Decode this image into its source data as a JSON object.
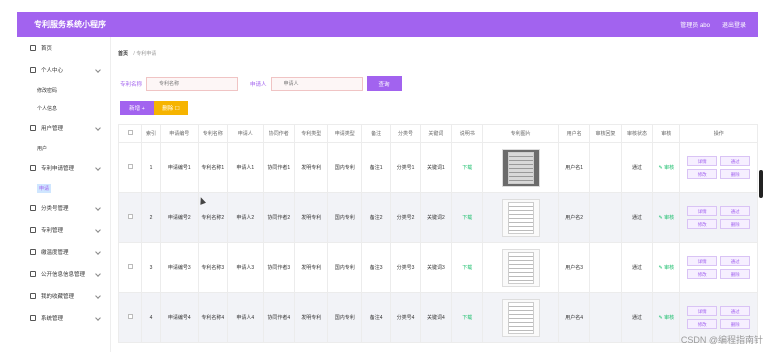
{
  "app": {
    "title": "专利服务系统小程序",
    "user": "管理员 abo",
    "logout": "退出登录"
  },
  "sidebar": {
    "items": [
      {
        "label": "首页"
      },
      {
        "label": "个人中心",
        "subs": [
          "修改密码",
          "个人信息"
        ]
      },
      {
        "label": "用户管理",
        "subs": [
          "用户"
        ]
      },
      {
        "label": "专利申请管理",
        "subs": [
          "申请"
        ]
      },
      {
        "label": "分类号管理"
      },
      {
        "label": "专利管理"
      },
      {
        "label": "缴温度管理"
      },
      {
        "label": "公开信息信息管理"
      },
      {
        "label": "我的收藏管理"
      },
      {
        "label": "系统管理"
      }
    ]
  },
  "breadcrumb": {
    "home": "首页",
    "sep": "/",
    "current": "专利申请"
  },
  "filters": {
    "label1": "专利名称",
    "placeholder1": "专利名称",
    "label2": "申请人",
    "placeholder2": "申请人",
    "search": "查询"
  },
  "actions": {
    "add": "新增 +",
    "delete": "删除 ☐"
  },
  "table": {
    "headers": [
      "索引",
      "申请编号",
      "专利名称",
      "申请人",
      "协同作者",
      "专利类型",
      "申请类型",
      "备注",
      "分类号",
      "关键词",
      "说明书",
      "专利图片",
      "用户名",
      "审核回复",
      "审核状态",
      "审核",
      "操作"
    ],
    "rows": [
      {
        "index": "1",
        "no": "申请编号1",
        "name": "专利名称1",
        "applicant": "申请人1",
        "coauthor": "协同作者1",
        "type": "发明专利",
        "apptype": "国内专利",
        "note": "备注1",
        "cls": "分类号1",
        "kw": "关键词1",
        "manual": "下载",
        "user": "用户名1",
        "reply": "",
        "status": "通过",
        "review": "审核"
      },
      {
        "index": "2",
        "no": "申请编号2",
        "name": "专利名称2",
        "applicant": "申请人2",
        "coauthor": "协同作者2",
        "type": "发明专利",
        "apptype": "国内专利",
        "note": "备注2",
        "cls": "分类号2",
        "kw": "关键词2",
        "manual": "下载",
        "user": "用户名2",
        "reply": "",
        "status": "通过",
        "review": "审核"
      },
      {
        "index": "3",
        "no": "申请编号3",
        "name": "专利名称3",
        "applicant": "申请人3",
        "coauthor": "协同作者3",
        "type": "发明专利",
        "apptype": "国内专利",
        "note": "备注3",
        "cls": "分类号3",
        "kw": "关键词3",
        "manual": "下载",
        "user": "用户名3",
        "reply": "",
        "status": "通过",
        "review": "审核"
      },
      {
        "index": "4",
        "no": "申请编号4",
        "name": "专利名称4",
        "applicant": "申请人4",
        "coauthor": "协同作者4",
        "type": "发明专利",
        "apptype": "国内专利",
        "note": "备注4",
        "cls": "分类号4",
        "kw": "关键词4",
        "manual": "下载",
        "user": "用户名4",
        "reply": "",
        "status": "通过",
        "review": "审核"
      }
    ],
    "ops": {
      "detail": "详情",
      "pass": "通过",
      "edit": "修改",
      "del": "删除"
    }
  },
  "watermark": "CSDN @编程指南针"
}
